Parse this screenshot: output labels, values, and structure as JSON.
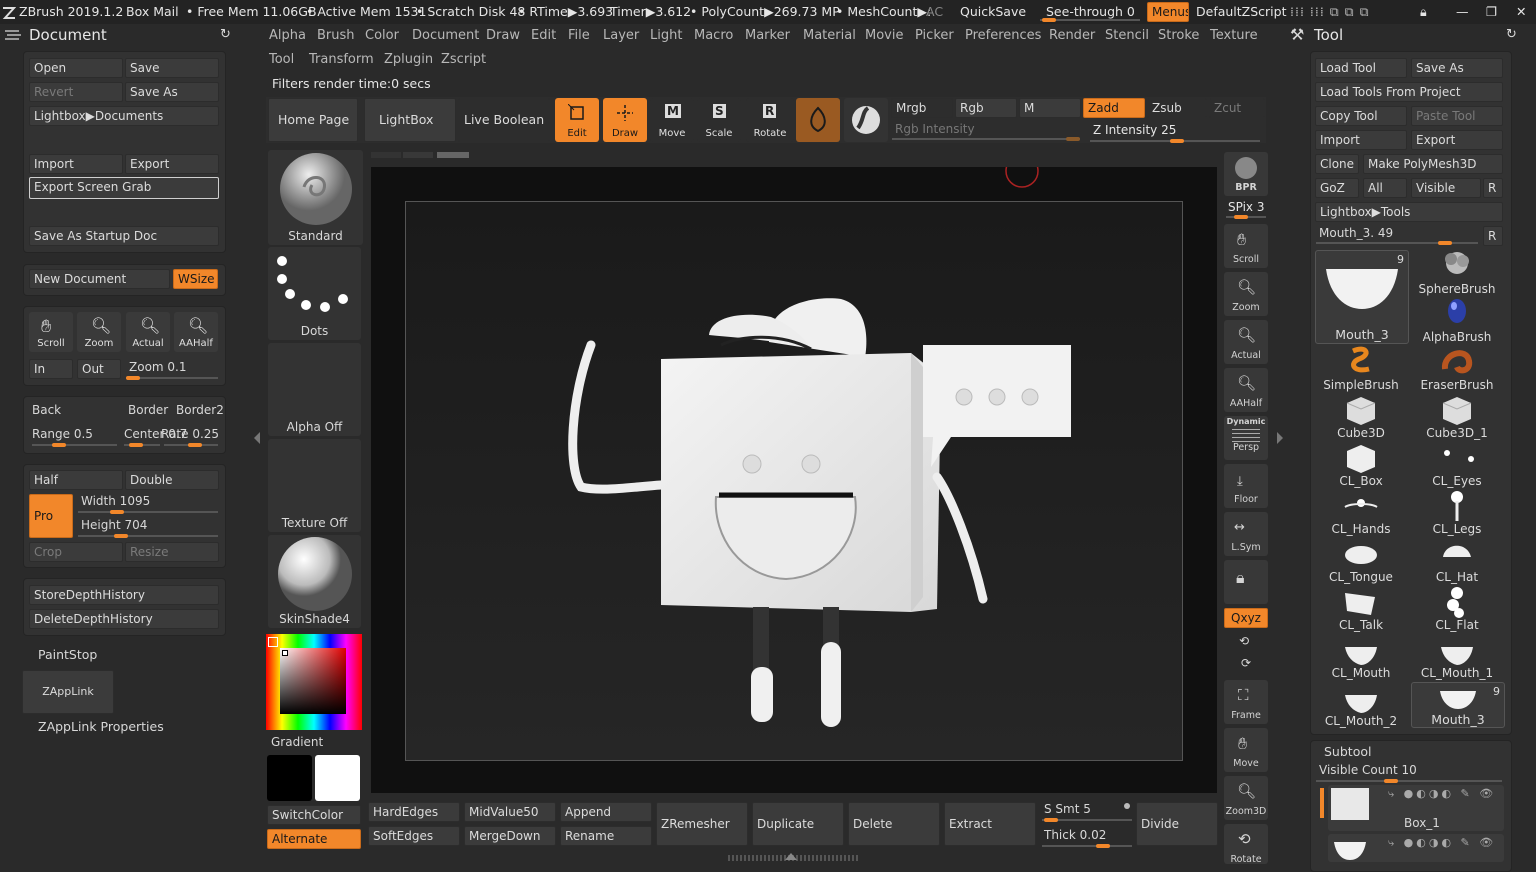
{
  "titlebar": {
    "app": "ZBrush 2019.1.2",
    "box_mail": "Box Mail",
    "free_mem": "• Free Mem 11.06GB",
    "active_mem": "• Active Mem 1531",
    "scratch": "• Scratch Disk 48",
    "rtime": "• RTime▶3.693",
    "timer": "Timer▶3.612",
    "polycount": "• PolyCount▶269.73 MP",
    "meshcount": "• MeshCount▶:",
    "ac": "AC",
    "quicksave": "QuickSave",
    "see_through": "See-through 0",
    "menus": "Menus",
    "default_zscript": "DefaultZScript"
  },
  "colors": {
    "accent": "#f2872a",
    "bg": "#2a2a2a",
    "panel": "#323232",
    "viewport": "#101010"
  },
  "document_panel": {
    "title": "Document",
    "open": "Open",
    "save": "Save",
    "revert": "Revert",
    "save_as": "Save As",
    "lightbox_documents": "Lightbox▶Documents",
    "import": "Import",
    "export": "Export",
    "export_screen_grab": "Export Screen Grab",
    "save_as_startup": "Save As Startup Doc",
    "new_document": "New Document",
    "wsize": "WSize",
    "scroll": "Scroll",
    "zoom": "Zoom",
    "actual": "Actual",
    "aahalf": "AAHalf",
    "in": "In",
    "out": "Out",
    "zoom_value": "Zoom 0.1",
    "back": "Back",
    "border": "Border",
    "border2": "Border2",
    "range": "Range 0.5",
    "center": "Center 0.7",
    "rate": "Rate 0.25",
    "half": "Half",
    "double": "Double",
    "pro": "Pro",
    "width": "Width 1095",
    "height": "Height 704",
    "crop": "Crop",
    "resize": "Resize",
    "store_depth": "StoreDepthHistory",
    "delete_depth": "DeleteDepthHistory",
    "paintstop": "PaintStop",
    "zapplink": "ZAppLink",
    "zapplink_props": "ZAppLink Properties"
  },
  "menubar": {
    "row1": [
      "Alpha",
      "Brush",
      "Color",
      "Document",
      "Draw",
      "Edit",
      "File",
      "Layer",
      "Light",
      "Macro",
      "Marker",
      "Material",
      "Movie",
      "Picker",
      "Preferences",
      "Render",
      "Stencil",
      "Stroke",
      "Texture"
    ],
    "row2": [
      "Tool",
      "Transform",
      "Zplugin",
      "Zscript"
    ]
  },
  "status": "Filters render time:0 secs",
  "shelf": {
    "home_page": "Home Page",
    "lightbox": "LightBox",
    "live_boolean": "Live Boolean",
    "edit": "Edit",
    "draw": "Draw",
    "move": "Move",
    "scale": "Scale",
    "rotate": "Rotate",
    "mrgb": "Mrgb",
    "rgb": "Rgb",
    "m": "M",
    "zadd": "Zadd",
    "zsub": "Zsub",
    "zcut": "Zcut",
    "rgb_intensity": "Rgb Intensity",
    "z_intensity": "Z Intensity 25"
  },
  "left_shelf": {
    "standard": "Standard",
    "dots": "Dots",
    "alpha_off": "Alpha Off",
    "texture_off": "Texture Off",
    "skinshade": "SkinShade4",
    "gradient": "Gradient",
    "switch_color": "SwitchColor",
    "alternate": "Alternate"
  },
  "right_shelf": {
    "bpr": "BPR",
    "spix": "SPix 3",
    "scroll": "Scroll",
    "zoom": "Zoom",
    "actual": "Actual",
    "aahalf": "AAHalf",
    "dynamic": "Dynamic",
    "persp": "Persp",
    "floor": "Floor",
    "lsym": "L.Sym",
    "xyz": "Qxyz",
    "frame": "Frame",
    "move": "Move",
    "zoom3d": "Zoom3D",
    "rotate": "Rotate"
  },
  "bottom_shelf": {
    "hardedges": "HardEdges",
    "midvalue": "MidValue50",
    "append": "Append",
    "softedges": "SoftEdges",
    "mergedown": "MergeDown",
    "rename": "Rename",
    "zremesher": "ZRemesher",
    "duplicate": "Duplicate",
    "delete": "Delete",
    "extract": "Extract",
    "s_smt": "S Smt 5",
    "thick": "Thick 0.02",
    "divide": "Divide"
  },
  "tool_panel": {
    "title": "Tool",
    "load_tool": "Load Tool",
    "save_as": "Save As",
    "load_from_project": "Load Tools From Project",
    "copy_tool": "Copy Tool",
    "paste_tool": "Paste Tool",
    "import": "Import",
    "export": "Export",
    "clone": "Clone",
    "make_polymesh": "Make PolyMesh3D",
    "goz": "GoZ",
    "all": "All",
    "visible": "Visible",
    "r": "R",
    "lightbox_tools": "Lightbox▶Tools",
    "mouth_slider": "Mouth_3. 49",
    "active_count": "9",
    "active_name": "Mouth_3",
    "tools": [
      "SphereBrush",
      "AlphaBrush",
      "SimpleBrush",
      "EraserBrush",
      "Cube3D",
      "Cube3D_1",
      "CL_Box",
      "CL_Eyes",
      "CL_Hands",
      "CL_Legs",
      "CL_Tongue",
      "CL_Hat",
      "CL_Talk",
      "CL_Flat",
      "CL_Mouth",
      "CL_Mouth_1",
      "CL_Mouth_2",
      "Mouth_3"
    ],
    "mouth3_count": "9",
    "subtool": "Subtool",
    "visible_count": "Visible Count 10",
    "subtool_item": "Box_1"
  }
}
